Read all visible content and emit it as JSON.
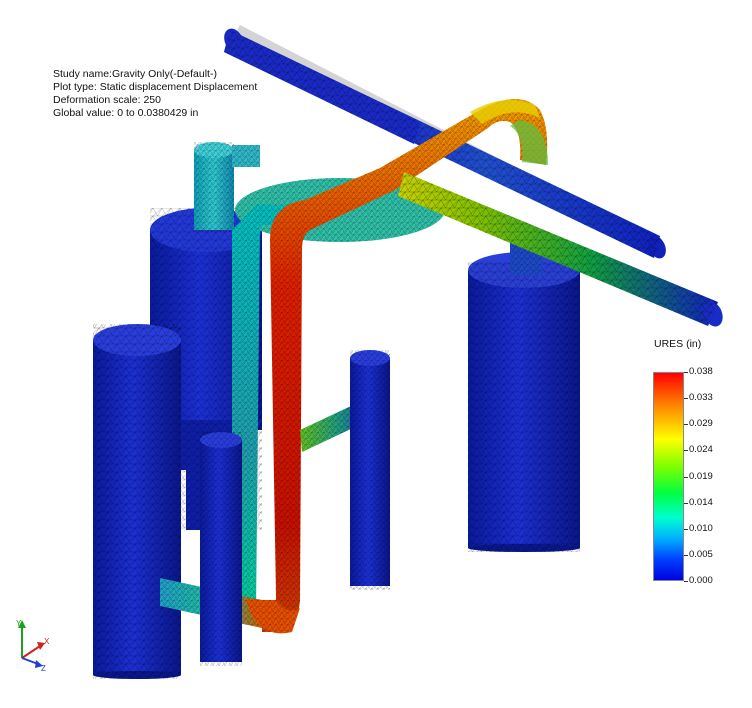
{
  "study_info": {
    "study_name": "Study name:Gravity Only(-Default-)",
    "plot_type": "Plot type: Static displacement Displacement",
    "deformation_scale": "Deformation scale: 250",
    "global_value": "Global value: 0 to 0.0380429 in"
  },
  "legend": {
    "title": "URES (in)",
    "ticks": [
      "0.038",
      "0.033",
      "0.029",
      "0.024",
      "0.019",
      "0.014",
      "0.010",
      "0.005",
      "0.000"
    ],
    "colors": [
      "#ff0000",
      "#ff8000",
      "#ffff00",
      "#80ff00",
      "#00ff40",
      "#00ffd0",
      "#00b0ff",
      "#0040ff",
      "#0000e0"
    ]
  },
  "triad": {
    "x_label": "X",
    "y_label": "Y",
    "z_label": "Z",
    "x_color": "#d02020",
    "y_color": "#20a020",
    "z_color": "#2040d0"
  }
}
